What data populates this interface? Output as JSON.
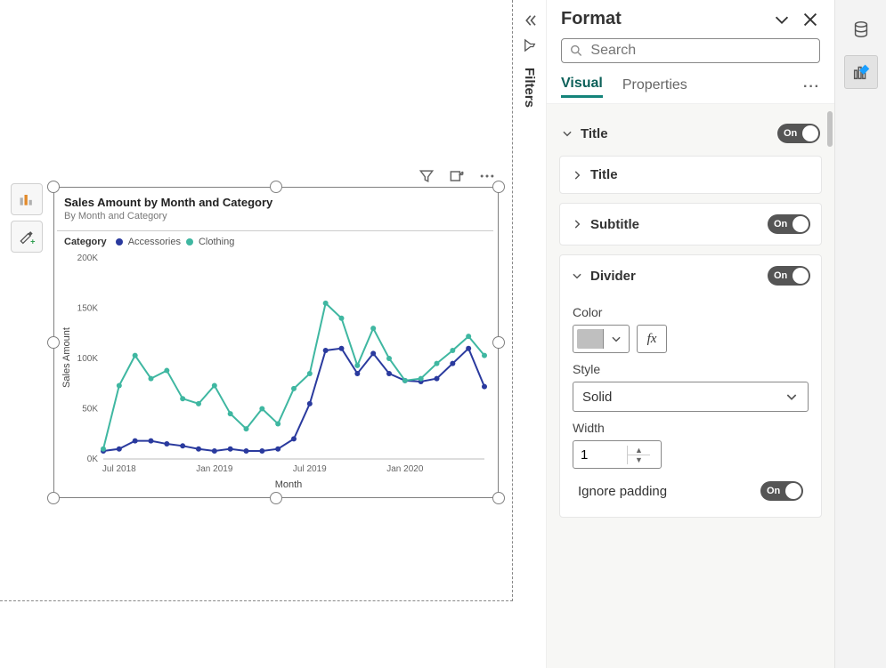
{
  "filters_label": "Filters",
  "format_panel": {
    "title": "Format",
    "search_placeholder": "Search",
    "tabs": {
      "visual": "Visual",
      "properties": "Properties"
    },
    "sections": {
      "title": {
        "label": "Title",
        "toggle": "On",
        "sub_title": "Title",
        "sub_subtitle": "Subtitle",
        "sub_subtitle_toggle": "On"
      },
      "divider": {
        "label": "Divider",
        "toggle": "On",
        "color_label": "Color",
        "fx_label": "fx",
        "style_label": "Style",
        "style_value": "Solid",
        "width_label": "Width",
        "width_value": "1",
        "ignore_padding_label": "Ignore padding",
        "ignore_padding_toggle": "On"
      }
    }
  },
  "chart_data": {
    "type": "line",
    "title": "Sales Amount by Month and Category",
    "subtitle": "By Month and Category",
    "xlabel": "Month",
    "ylabel": "Sales Amount",
    "ylim": [
      0,
      200000
    ],
    "y_ticks": [
      "0K",
      "50K",
      "100K",
      "150K",
      "200K"
    ],
    "x_tick_labels": [
      "Jul 2018",
      "Jan 2019",
      "Jul 2019",
      "Jan 2020"
    ],
    "legend_title": "Category",
    "categories": [
      "Jun 2018",
      "Jul 2018",
      "Aug 2018",
      "Sep 2018",
      "Oct 2018",
      "Nov 2018",
      "Dec 2018",
      "Jan 2019",
      "Feb 2019",
      "Mar 2019",
      "Apr 2019",
      "May 2019",
      "Jun 2019",
      "Jul 2019",
      "Aug 2019",
      "Sep 2019",
      "Oct 2019",
      "Nov 2019",
      "Dec 2019",
      "Jan 2020",
      "Feb 2020",
      "Mar 2020",
      "Apr 2020",
      "May 2020",
      "Jun 2020"
    ],
    "series": [
      {
        "name": "Accessories",
        "color": "#2a3a9e",
        "values": [
          8000,
          10000,
          18000,
          18000,
          15000,
          13000,
          10000,
          8000,
          10000,
          8000,
          8000,
          10000,
          20000,
          55000,
          108000,
          110000,
          85000,
          105000,
          85000,
          78000,
          77000,
          80000,
          95000,
          110000,
          72000
        ]
      },
      {
        "name": "Clothing",
        "color": "#3fb7a1",
        "values": [
          10000,
          73000,
          103000,
          80000,
          88000,
          60000,
          55000,
          73000,
          45000,
          30000,
          50000,
          35000,
          70000,
          85000,
          155000,
          140000,
          93000,
          130000,
          100000,
          78000,
          80000,
          95000,
          108000,
          122000,
          103000
        ]
      }
    ]
  }
}
